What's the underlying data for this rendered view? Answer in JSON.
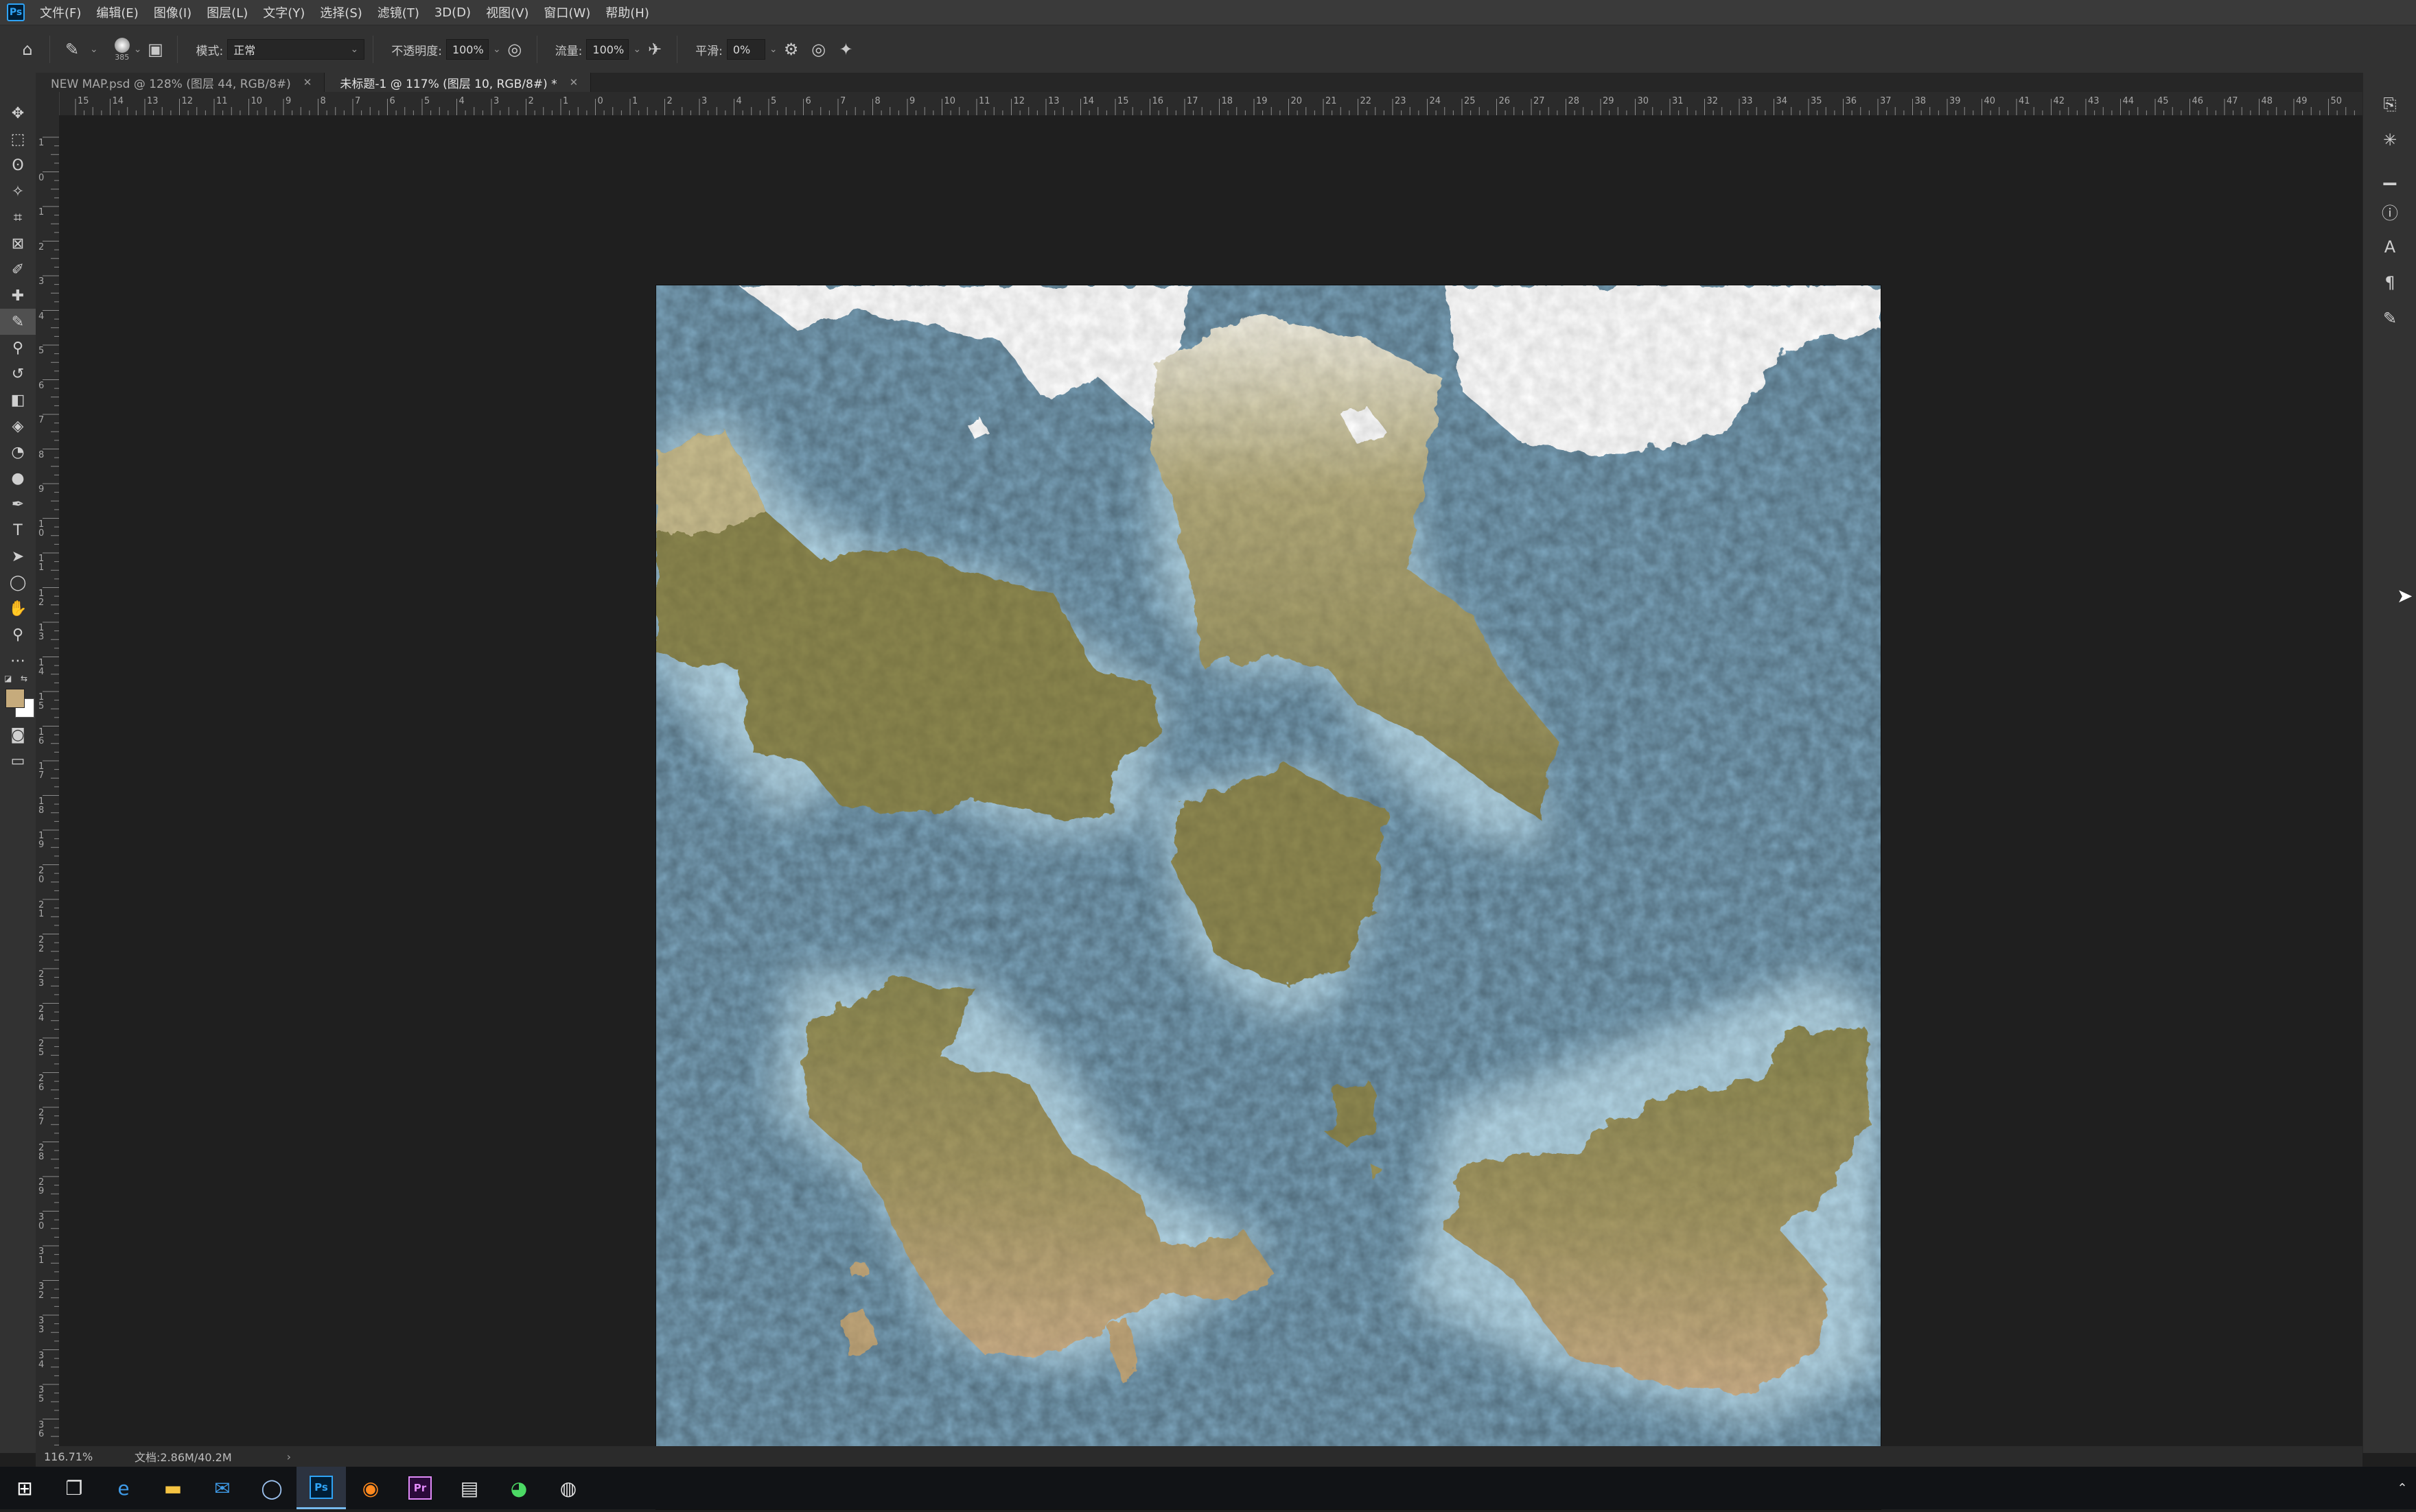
{
  "menubar": {
    "items": [
      "文件(F)",
      "编辑(E)",
      "图像(I)",
      "图层(L)",
      "文字(Y)",
      "选择(S)",
      "滤镜(T)",
      "3D(D)",
      "视图(V)",
      "窗口(W)",
      "帮助(H)"
    ]
  },
  "options": {
    "brush_size": "385",
    "mode_label": "模式:",
    "mode_value": "正常",
    "opacity_label": "不透明度:",
    "opacity_value": "100%",
    "flow_label": "流量:",
    "flow_value": "100%",
    "smoothing_label": "平滑:",
    "smoothing_value": "0%"
  },
  "tabs": [
    {
      "label": "NEW MAP.psd @ 128% (图层 44, RGB/8#)",
      "active": false
    },
    {
      "label": "未标题-1 @ 117% (图层 10, RGB/8#) *",
      "active": true
    }
  ],
  "status": {
    "zoom": "116.71%",
    "doc_info": "文档:2.86M/40.2M"
  },
  "ruler": {
    "top_labels": [
      "15",
      "14",
      "13",
      "12",
      "11",
      "10",
      "9",
      "8",
      "7",
      "6",
      "5",
      "4",
      "3",
      "2",
      "1",
      "0",
      "1",
      "2",
      "3",
      "4",
      "5",
      "6",
      "7",
      "8",
      "9",
      "10",
      "11",
      "12",
      "13",
      "14",
      "15",
      "16",
      "17",
      "18",
      "19",
      "20",
      "21",
      "22",
      "23",
      "24",
      "25",
      "26",
      "27",
      "28",
      "29",
      "30",
      "31",
      "32",
      "33",
      "34",
      "35",
      "36",
      "37",
      "38",
      "39",
      "40",
      "41",
      "42",
      "43",
      "44",
      "45",
      "46",
      "47",
      "48",
      "49",
      "50"
    ],
    "left_labels": [
      "1",
      "0",
      "1",
      "2",
      "3",
      "4",
      "5",
      "6",
      "7",
      "8",
      "9",
      "1 0",
      "1 1",
      "1 2",
      "1 3",
      "1 4",
      "1 5",
      "1 6",
      "1 7",
      "1 8",
      "1 9",
      "2 0",
      "2 1",
      "2 2",
      "2 3",
      "2 4",
      "2 5",
      "2 6",
      "2 7",
      "2 8",
      "2 9",
      "3 0",
      "3 1",
      "3 2",
      "3 3",
      "3 4",
      "3 5",
      "3 6"
    ]
  },
  "colors": {
    "ocean": "#7da6be",
    "land": "#8f8a55",
    "sand": "#c6ab7c",
    "ice": "#ffffff",
    "foreground_swatch": "#c6ab7c",
    "background_swatch": "#ffffff"
  }
}
